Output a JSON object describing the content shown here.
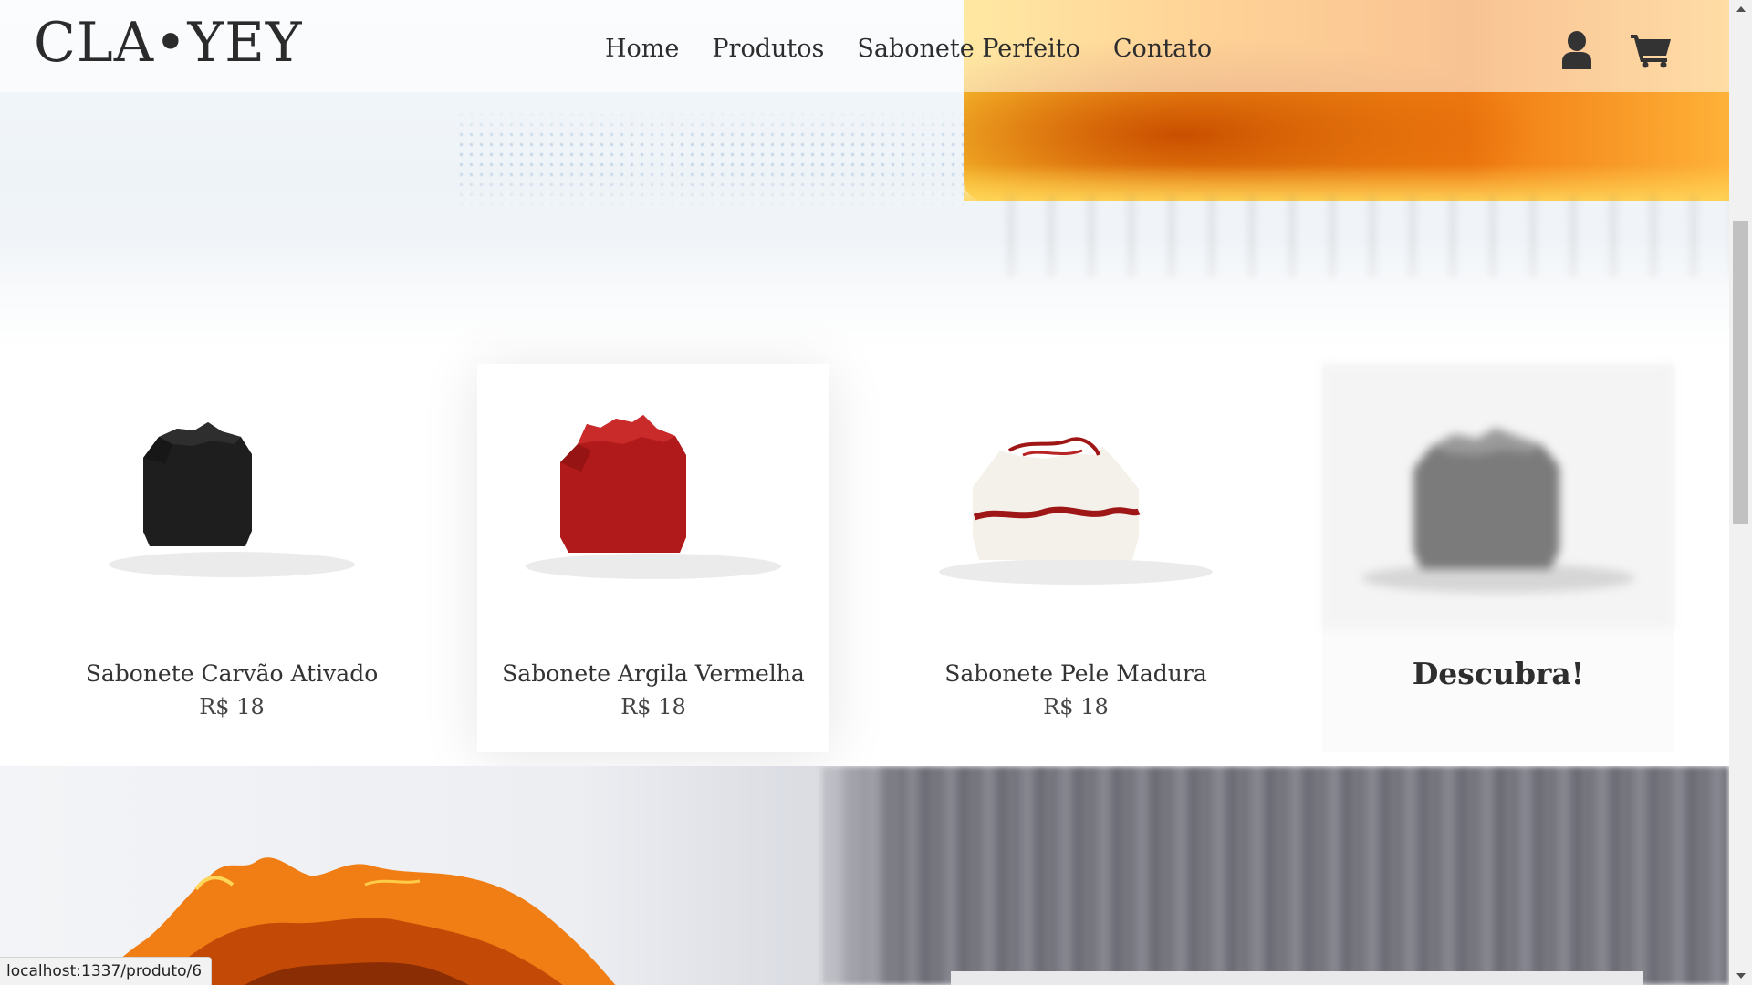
{
  "brand": {
    "logo_text": "CLA•YEY"
  },
  "nav": {
    "items": [
      {
        "label": "Home"
      },
      {
        "label": "Produtos"
      },
      {
        "label": "Sabonete Perfeito"
      },
      {
        "label": "Contato"
      }
    ]
  },
  "header_icons": {
    "user": "user-icon",
    "cart": "cart-icon"
  },
  "products": [
    {
      "name": "Sabonete Carvão Ativado",
      "price": "R$ 18",
      "soap_color": "#1e1e1e"
    },
    {
      "name": "Sabonete Argila Vermelha",
      "price": "R$ 18",
      "soap_color": "#b11a1a"
    },
    {
      "name": "Sabonete Pele Madura",
      "price": "R$ 18",
      "soap_color": "#f4f1ea"
    }
  ],
  "discover": {
    "label": "Descubra!"
  },
  "status_bar": {
    "url": "localhost:1337/produto/6"
  },
  "colors": {
    "accent_orange": "#f08a1a",
    "text_dark": "#2d2d2d"
  }
}
